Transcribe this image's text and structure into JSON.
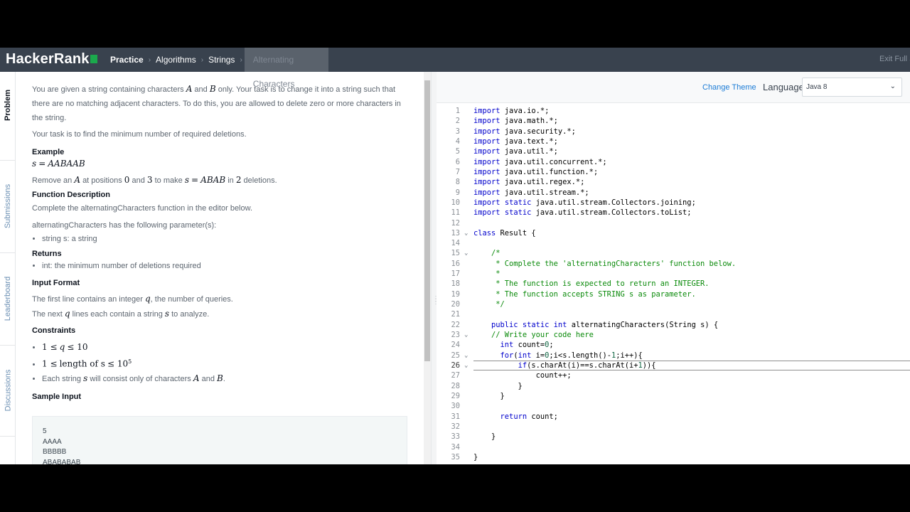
{
  "topnav": {
    "logo": "HackerRank",
    "breadcrumbs": [
      "Practice",
      "Algorithms",
      "Strings",
      "Alternating Characters"
    ],
    "exit_fullscreen": "Exit Full S"
  },
  "left_tabs": [
    "Problem",
    "Submissions",
    "Leaderboard",
    "Discussions"
  ],
  "problem": {
    "intro_1": "You are given a string containing characters",
    "var_A": "A",
    "and": "and",
    "var_B": "B",
    "intro_2": "only. Your task is to change it into a string such that there",
    "intro_3": "are no matching adjacent characters. To do this, you are allowed to delete zero or more characters in the string.",
    "task": "Your task is to find the minimum number of required deletions.",
    "example_heading": "Example",
    "example_var": "s",
    "example_eq": "=",
    "example_value": "AABAAB",
    "remove_1": "Remove an",
    "remove_2": "at positions",
    "remove_pos1": "0",
    "remove_pos2": "3",
    "remove_3": "to make",
    "remove_value": "ABAB",
    "remove_4": "in",
    "remove_count": "2",
    "remove_5": "deletions.",
    "fd_heading": "Function Description",
    "fd_text": "Complete the alternatingCharacters function in the editor below.",
    "fd_params": "alternatingCharacters has the following parameter(s):",
    "fd_param_item": "string s: a string",
    "returns_heading": "Returns",
    "returns_item": "int: the minimum number of deletions required",
    "input_heading": "Input Format",
    "input_1a": "The first line contains an integer",
    "input_var_q": "q",
    "input_1b": ", the number of queries.",
    "input_2a": "The next",
    "input_2b": "lines each contain a string",
    "input_var_s": "s",
    "input_2c": "to analyze.",
    "constraints_heading": "Constraints",
    "c1_a": "1 ≤",
    "c1_q": "q",
    "c1_b": "≤ 10",
    "c2_a": "1 ≤",
    "c2_b": "length of s",
    "c2_c": "≤ 10",
    "c2_exp": "5",
    "c3_a": "Each string",
    "c3_b": "will consist only of characters",
    "c3_c": ".",
    "sample_heading": "Sample Input",
    "sample_lines": [
      "5",
      "AAAA",
      "BBBBB",
      "ABABABAB"
    ]
  },
  "editor": {
    "change_theme": "Change Theme",
    "language_label": "Language",
    "language_value": "Java 8",
    "active_line": 26,
    "lines": [
      "import java.io.*;",
      "import java.math.*;",
      "import java.security.*;",
      "import java.text.*;",
      "import java.util.*;",
      "import java.util.concurrent.*;",
      "import java.util.function.*;",
      "import java.util.regex.*;",
      "import java.util.stream.*;",
      "import static java.util.stream.Collectors.joining;",
      "import static java.util.stream.Collectors.toList;",
      "",
      "class Result {",
      "",
      "    /*",
      "     * Complete the 'alternatingCharacters' function below.",
      "     *",
      "     * The function is expected to return an INTEGER.",
      "     * The function accepts STRING s as parameter.",
      "     */",
      "",
      "    public static int alternatingCharacters(String s) {",
      "    // Write your code here",
      "      int count=0;",
      "      for(int i=0;i<s.length()-1;i++){",
      "          if(s.charAt(i)==s.charAt(i+1)){",
      "              count++;",
      "          }",
      "      }",
      "",
      "      return count;",
      "",
      "    }",
      "",
      "}"
    ],
    "folds": [
      13,
      15,
      23,
      25,
      26
    ]
  }
}
